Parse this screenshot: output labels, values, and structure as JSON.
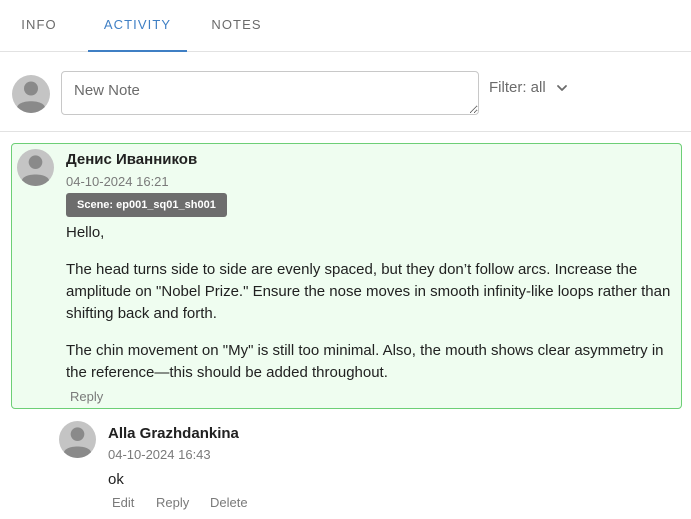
{
  "tabs": [
    {
      "label": "INFO",
      "active": false
    },
    {
      "label": "ACTIVITY",
      "active": true
    },
    {
      "label": "NOTES",
      "active": false
    }
  ],
  "composer": {
    "avatar_icon": "user-avatar-icon",
    "note_placeholder": "New Note",
    "note_value": "",
    "filter_label": "Filter: all",
    "filter_icon": "chevron-down-icon"
  },
  "comment": {
    "author": "Денис Иванников",
    "timestamp": "04-10-2024 16:21",
    "scene_badge": "Scene: ep001_sq01_sh001",
    "paragraphs": [
      "Hello,",
      "The head turns side to side are evenly spaced, but they don’t follow arcs. Increase the amplitude on \"Nobel Prize.\" Ensure the nose moves in smooth infinity-like loops rather than shifting back and forth.",
      "The chin movement on \"My\" is still too minimal. Also, the mouth shows clear asymmetry in the reference—this should be added throughout."
    ],
    "reply_label": "Reply",
    "highlight_color": "#effdf0",
    "border_color": "#6dcf76"
  },
  "reply": {
    "author": "Alla Grazhdankina",
    "timestamp": "04-10-2024 16:43",
    "text": "ok",
    "actions": {
      "edit": "Edit",
      "reply": "Reply",
      "delete": "Delete"
    }
  },
  "colors": {
    "accent": "#3f7fc4",
    "badge_bg": "#6d6d6d",
    "muted_text": "#7a7a7a"
  }
}
